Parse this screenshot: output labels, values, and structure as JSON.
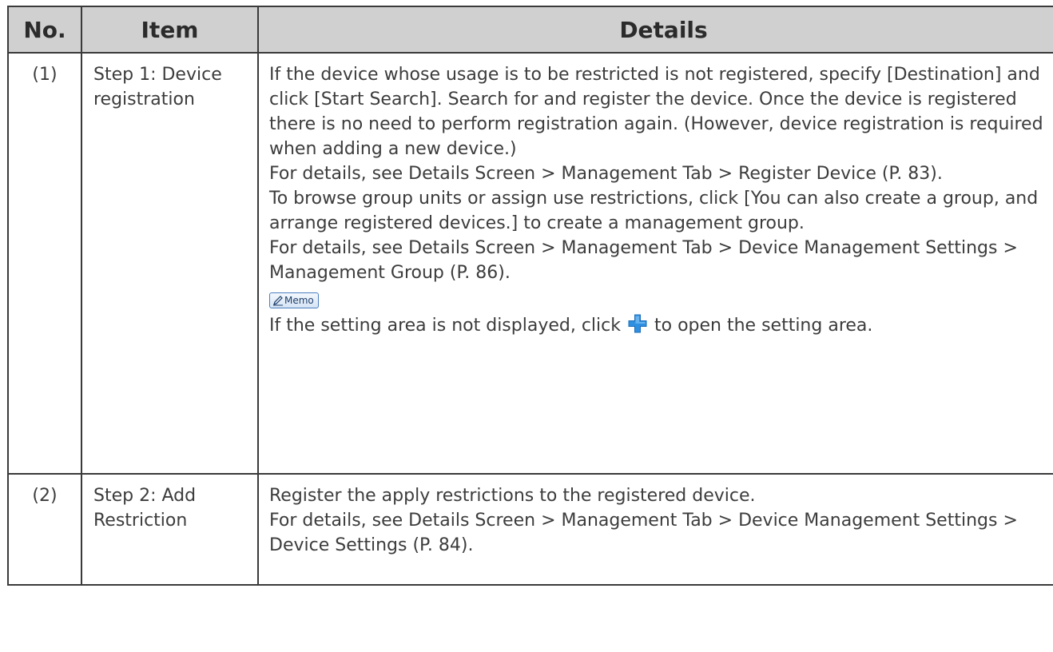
{
  "table": {
    "headers": {
      "no": "No.",
      "item": "Item",
      "details": "Details"
    },
    "rows": [
      {
        "no": "(1)",
        "item": "Step 1: Device registration",
        "details": {
          "p1": "If the device whose usage is to be restricted is not registered, specify [Destination] and click [Start Search]. Search for and register the device. Once the device is registered there is no need to perform registration again. (However, device registration is required when adding a new device.)",
          "p2": "For details, see Details Screen > Management Tab > Register Device (P. 83).",
          "p3": "To browse group units or assign use restrictions, click [You can also create a group, and arrange registered devices.] to create a management group.",
          "p4": "For details, see Details Screen > Management Tab > Device Management Settings > Management Group (P. 86).",
          "memo_label": "Memo",
          "memo_text_before": "If the setting area is not displayed, click",
          "memo_text_after": "to open the setting area."
        }
      },
      {
        "no": "(2)",
        "item": "Step 2: Add Restriction",
        "details": {
          "p1": "Register the apply restrictions to the registered device.",
          "p2": "For details, see Details Screen > Management Tab > Device Management Settings > Device Settings (P. 84)."
        }
      }
    ]
  },
  "icons": {
    "memo": "pencil-memo-icon",
    "expand": "blue-plus-icon"
  },
  "colors": {
    "header_bg": "#d0d0d0",
    "border": "#3a3a3a",
    "text": "#3c3c3c",
    "plus_icon": "#2f8fe0"
  }
}
